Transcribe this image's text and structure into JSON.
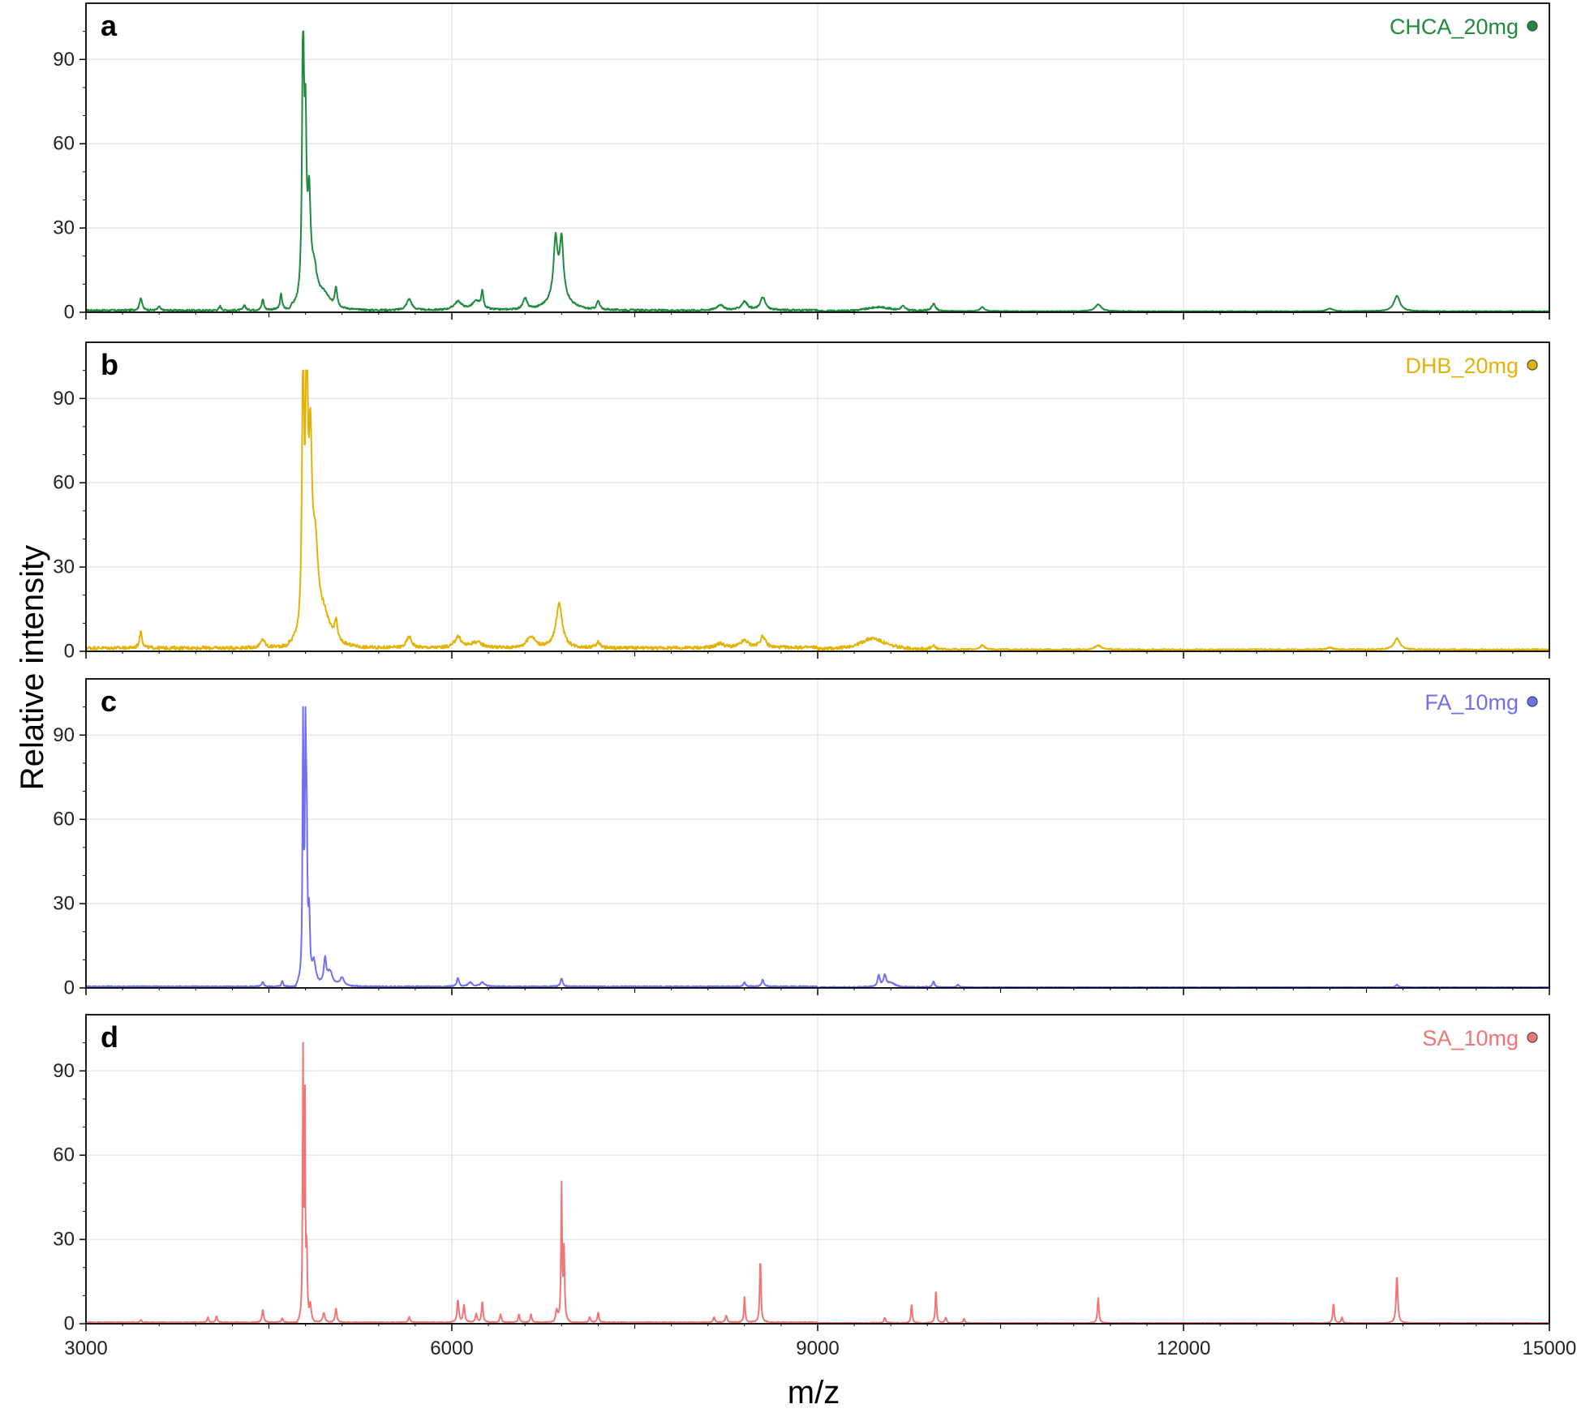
{
  "chart_data": {
    "type": "line",
    "xlabel": "m/z",
    "ylabel": "Relative intensity",
    "xlim": [
      3000,
      15000
    ],
    "ylim": [
      0,
      110
    ],
    "x_ticks": [
      3000,
      6000,
      9000,
      12000,
      15000
    ],
    "y_ticks": [
      0,
      30,
      60,
      90
    ],
    "grid": true,
    "legend_position": "top-right",
    "series": [
      {
        "panel": "a",
        "name": "CHCA_20mg",
        "color": "#1f8a3c",
        "baseline": 0.7,
        "noise": 0.6,
        "peaks": [
          [
            3450,
            4.5,
            12
          ],
          [
            3600,
            1.5,
            10
          ],
          [
            4100,
            1.5,
            10
          ],
          [
            4300,
            2,
            10
          ],
          [
            4450,
            4,
            10
          ],
          [
            4600,
            5.5,
            10
          ],
          [
            4780,
            100,
            9
          ],
          [
            4800,
            55,
            10
          ],
          [
            4830,
            33,
            14
          ],
          [
            4870,
            12,
            35
          ],
          [
            4950,
            5,
            60
          ],
          [
            5050,
            7,
            12
          ],
          [
            5650,
            4,
            25
          ],
          [
            6050,
            3,
            40
          ],
          [
            6200,
            3,
            40
          ],
          [
            6250,
            6,
            10
          ],
          [
            6600,
            4,
            20
          ],
          [
            6850,
            19,
            18
          ],
          [
            6900,
            18,
            16
          ],
          [
            6880,
            8,
            70
          ],
          [
            7200,
            3,
            15
          ],
          [
            8200,
            2,
            30
          ],
          [
            8400,
            3,
            30
          ],
          [
            8550,
            4.5,
            25
          ],
          [
            9500,
            1.5,
            120
          ],
          [
            9700,
            1.5,
            20
          ],
          [
            9950,
            2.5,
            20
          ],
          [
            10350,
            1.5,
            20
          ],
          [
            11300,
            2.5,
            30
          ],
          [
            13200,
            1,
            30
          ],
          [
            13750,
            5.5,
            30
          ]
        ]
      },
      {
        "panel": "b",
        "name": "DHB_20mg",
        "color": "#e3b209",
        "baseline": 1.2,
        "noise": 1.2,
        "peaks": [
          [
            3450,
            6,
            12
          ],
          [
            4450,
            3,
            20
          ],
          [
            4780,
            95,
            10
          ],
          [
            4810,
            100,
            10
          ],
          [
            4840,
            60,
            16
          ],
          [
            4880,
            30,
            30
          ],
          [
            4950,
            10,
            60
          ],
          [
            5050,
            7,
            15
          ],
          [
            5650,
            4,
            25
          ],
          [
            6050,
            4,
            30
          ],
          [
            6200,
            2,
            60
          ],
          [
            6650,
            4,
            40
          ],
          [
            6880,
            16,
            30
          ],
          [
            7200,
            2,
            20
          ],
          [
            8200,
            1.5,
            40
          ],
          [
            8400,
            2.5,
            40
          ],
          [
            8550,
            4,
            25
          ],
          [
            9450,
            4,
            120
          ],
          [
            9950,
            1,
            20
          ],
          [
            10350,
            1.5,
            20
          ],
          [
            11300,
            1.5,
            30
          ],
          [
            13200,
            0.8,
            30
          ],
          [
            13750,
            4,
            30
          ]
        ]
      },
      {
        "panel": "c",
        "name": "FA_10mg",
        "color": "#6f6ff0",
        "baseline": 0.5,
        "noise": 0.4,
        "peaks": [
          [
            4450,
            1.5,
            10
          ],
          [
            4610,
            2,
            8
          ],
          [
            4780,
            100,
            5
          ],
          [
            4800,
            80,
            6
          ],
          [
            4810,
            46,
            6
          ],
          [
            4830,
            22,
            8
          ],
          [
            4870,
            8,
            20
          ],
          [
            4960,
            9,
            12
          ],
          [
            5000,
            5,
            25
          ],
          [
            5100,
            3,
            20
          ],
          [
            6050,
            3,
            10
          ],
          [
            6150,
            1.5,
            20
          ],
          [
            6250,
            1.5,
            20
          ],
          [
            6900,
            3,
            10
          ],
          [
            8400,
            1.5,
            10
          ],
          [
            8550,
            2.5,
            10
          ],
          [
            9500,
            4,
            12
          ],
          [
            9550,
            4,
            12
          ],
          [
            9600,
            1.5,
            40
          ],
          [
            9950,
            2,
            10
          ],
          [
            10150,
            1,
            10
          ],
          [
            13750,
            1,
            10
          ]
        ]
      },
      {
        "panel": "d",
        "name": "SA_10mg",
        "color": "#f07575",
        "baseline": 0.5,
        "noise": 0.3,
        "peaks": [
          [
            3450,
            1,
            6
          ],
          [
            4000,
            2,
            6
          ],
          [
            4070,
            2.5,
            6
          ],
          [
            4450,
            4.5,
            8
          ],
          [
            4610,
            1.5,
            8
          ],
          [
            4780,
            100,
            4
          ],
          [
            4795,
            80,
            4
          ],
          [
            4810,
            25,
            5
          ],
          [
            4840,
            6,
            10
          ],
          [
            4950,
            3.5,
            10
          ],
          [
            5050,
            5,
            8
          ],
          [
            5650,
            2,
            8
          ],
          [
            6050,
            8,
            8
          ],
          [
            6100,
            6,
            8
          ],
          [
            6200,
            3,
            8
          ],
          [
            6250,
            7.5,
            7
          ],
          [
            6400,
            3,
            7
          ],
          [
            6550,
            3,
            7
          ],
          [
            6650,
            3,
            7
          ],
          [
            6900,
            48,
            5
          ],
          [
            6920,
            25,
            6
          ],
          [
            6860,
            4,
            10
          ],
          [
            7200,
            3.5,
            7
          ],
          [
            7130,
            2,
            7
          ],
          [
            8150,
            2,
            8
          ],
          [
            8250,
            2.5,
            8
          ],
          [
            8400,
            9,
            6
          ],
          [
            8530,
            23,
            6
          ],
          [
            9550,
            2,
            8
          ],
          [
            9770,
            7,
            6
          ],
          [
            9970,
            12,
            6
          ],
          [
            10050,
            2,
            8
          ],
          [
            10200,
            1.5,
            8
          ],
          [
            11300,
            9,
            7
          ],
          [
            13230,
            7,
            7
          ],
          [
            13300,
            2,
            7
          ],
          [
            13750,
            17,
            8
          ]
        ]
      }
    ]
  }
}
